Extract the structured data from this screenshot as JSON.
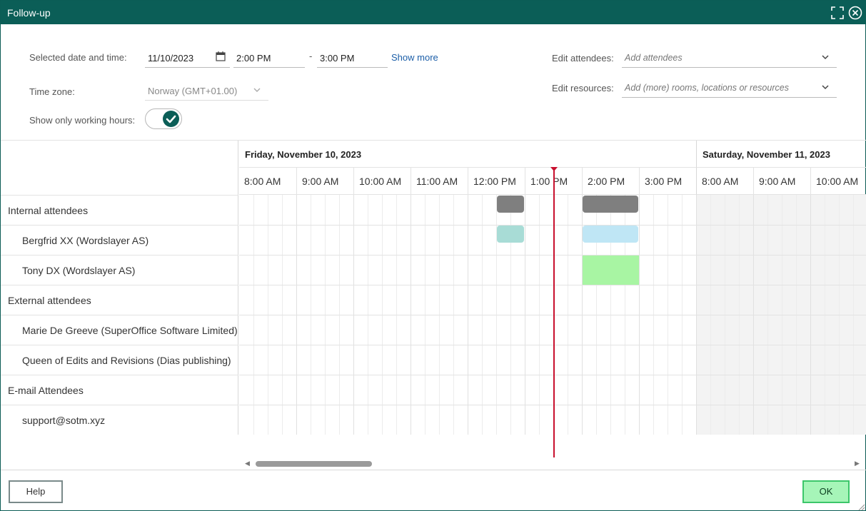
{
  "window": {
    "title": "Follow-up"
  },
  "form": {
    "date_label": "Selected date and time:",
    "date_value": "11/10/2023",
    "start_time": "2:00 PM",
    "time_separator": "-",
    "end_time": "3:00 PM",
    "show_more": "Show more",
    "timezone_label": "Time zone:",
    "timezone_value": "Norway (GMT+01.00)",
    "working_hours_label": "Show only working hours:",
    "working_hours_on": true,
    "attendees_label": "Edit attendees:",
    "attendees_placeholder": "Add attendees",
    "resources_label": "Edit resources:",
    "resources_placeholder": "Add (more) rooms, locations or resources"
  },
  "schedule": {
    "days": [
      {
        "label": "Friday, November 10, 2023",
        "hours": [
          "8:00 AM",
          "9:00 AM",
          "10:00 AM",
          "11:00 AM",
          "12:00 PM",
          "1:00 PM",
          "2:00 PM",
          "3:00 PM"
        ]
      },
      {
        "label": "Saturday, November 11, 2023",
        "hours": [
          "8:00 AM",
          "9:00 AM",
          "10:00 AM"
        ]
      }
    ],
    "rows": [
      {
        "label": "Internal attendees",
        "group": true
      },
      {
        "label": "Bergfrid XX (Wordslayer AS)",
        "group": false
      },
      {
        "label": "Tony DX (Wordslayer AS)",
        "group": false
      },
      {
        "label": "External attendees",
        "group": true
      },
      {
        "label": "Marie De Greeve (SuperOffice Software Limited)",
        "group": false
      },
      {
        "label": "Queen of Edits and Revisions (Dias publishing)",
        "group": false
      },
      {
        "label": "E-mail Attendees",
        "group": true
      },
      {
        "label": "support@sotm.xyz",
        "group": false
      }
    ],
    "colors": {
      "group_busy": "#7f7f7f",
      "tentative": "#a8dcd6",
      "selected": "#bfe6f5",
      "free_selection": "#a8f5a3",
      "now_line": "#c8102e"
    }
  },
  "footer": {
    "help_label": "Help",
    "ok_label": "OK"
  }
}
